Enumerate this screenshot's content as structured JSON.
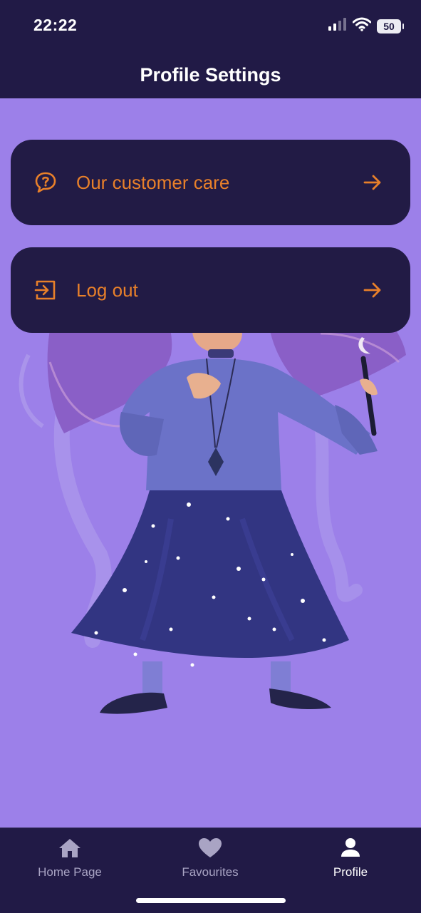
{
  "status_bar": {
    "time": "22:22",
    "battery": "50",
    "signal_icon": "signal-icon",
    "wifi_icon": "wifi-icon"
  },
  "header": {
    "title": "Profile Settings"
  },
  "menu": [
    {
      "label": "Our customer care",
      "icon": "chat-question-icon",
      "arrow_icon": "arrow-right-icon"
    },
    {
      "label": "Log out",
      "icon": "logout-icon",
      "arrow_icon": "arrow-right-icon"
    }
  ],
  "bottom_nav": [
    {
      "label": "Home Page",
      "icon": "home-icon",
      "active": false
    },
    {
      "label": "Favourites",
      "icon": "heart-icon",
      "active": false
    },
    {
      "label": "Profile",
      "icon": "person-icon",
      "active": true
    }
  ],
  "colors": {
    "background": "#211a46",
    "content_background": "#9c80e9",
    "card": "#221b45",
    "accent": "#e8802a"
  }
}
